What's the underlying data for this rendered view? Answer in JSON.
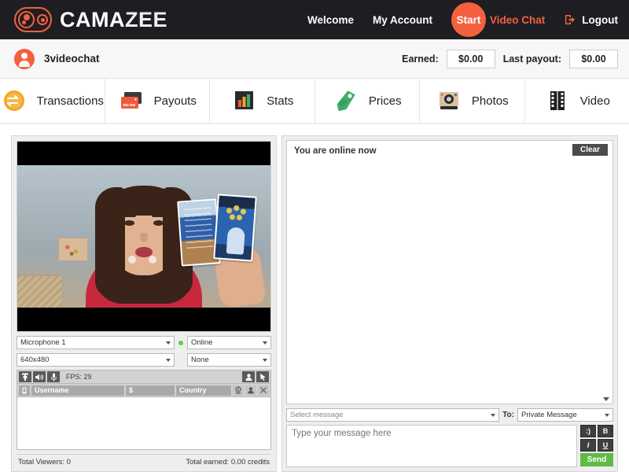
{
  "brand": {
    "name_part1": "CAMA",
    "name_part2": "ZEE",
    "accent_color": "#f4603e",
    "logo_icon": "camera-logo-icon"
  },
  "topnav": {
    "welcome": "Welcome",
    "my_account": "My Account",
    "start": "Start",
    "video_chat": "Video Chat",
    "logout": "Logout"
  },
  "userbar": {
    "username": "3videochat",
    "earned_label": "Earned:",
    "earned_value": "$0.00",
    "last_payout_label": "Last payout:",
    "last_payout_value": "$0.00"
  },
  "tabs": [
    {
      "label": "Transactions",
      "icon": "coin-exchange-icon"
    },
    {
      "label": "Payouts",
      "icon": "credit-card-icon"
    },
    {
      "label": "Stats",
      "icon": "bar-chart-icon"
    },
    {
      "label": "Prices",
      "icon": "price-tag-icon"
    },
    {
      "label": "Photos",
      "icon": "camera-icon"
    },
    {
      "label": "Video",
      "icon": "film-strip-icon"
    }
  ],
  "video": {
    "microphone_value": "Microphone 1",
    "resolution_value": "640x480",
    "status_value": "Online",
    "secondary_value": "None",
    "fps_label": "FPS: 29",
    "toolbar_icons": [
      "camera-toggle-icon",
      "speaker-icon",
      "microphone-icon"
    ],
    "toolbar_right_icons": [
      "user-profile-icon",
      "settings-pointer-icon"
    ],
    "userlist_columns": [
      "Username",
      "$",
      "Country"
    ],
    "userlist_lead_icon": "device-icon",
    "userlist_right_icons": [
      "webcam-icon",
      "user-icon",
      "close-icon"
    ],
    "total_viewers": "Total Viewers: 0",
    "total_earned": "Total earned: 0.00 credits"
  },
  "chat": {
    "status": "You are online now",
    "clear_label": "Clear",
    "select_message_placeholder": "Select message",
    "to_label": "To:",
    "to_value": "Private Message",
    "message_placeholder": "Type your message here",
    "format_buttons": [
      ":)",
      "B",
      "I",
      "U"
    ],
    "send_label": "Send"
  }
}
